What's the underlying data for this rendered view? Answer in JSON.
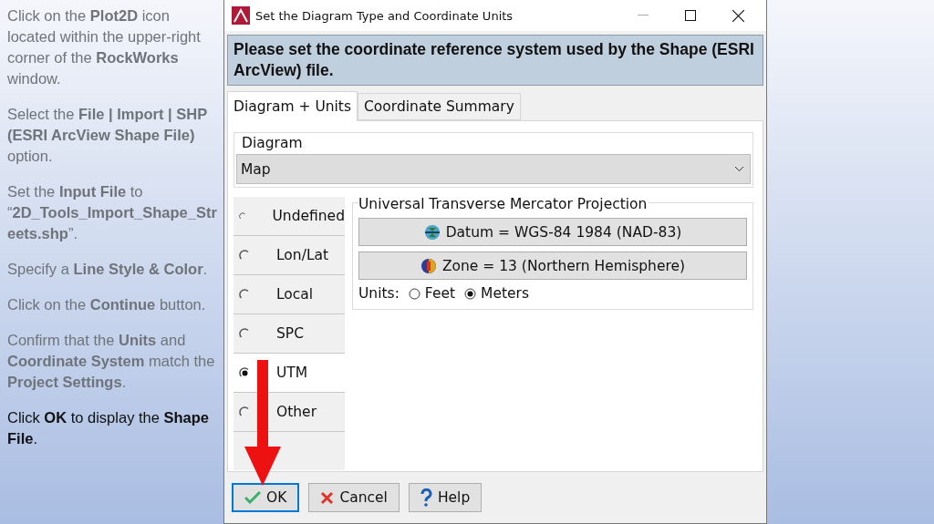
{
  "slide_steps": [
    {
      "text": "Click on the **Plot2D** icon located within the upper-right corner of the **RockWorks** window.",
      "current": false
    },
    {
      "text": "Select the **File | Import | SHP (ESRI ArcView Shape File)** option.",
      "current": false
    },
    {
      "text": "Set the **Input File** to “**2D_Tools_Import_Shape_Streets.shp**”.",
      "current": false
    },
    {
      "text": "Specify a **Line Style & Color**.",
      "current": false
    },
    {
      "text": "Click on the **Continue** button.",
      "current": false
    },
    {
      "text": "Confirm that the **Units** and **Coordinate System** match the **Project Settings**.",
      "current": false
    },
    {
      "text": "Click **OK** to display the **Shape File**.",
      "current": true
    }
  ],
  "dialog": {
    "title": "Set the Diagram Type and Coordinate Units",
    "header": "Please set the coordinate reference system used by the Shape (ESRI ArcView) file.",
    "tabs": [
      {
        "label": "Diagram + Units",
        "selected": true
      },
      {
        "label": "Coordinate Summary",
        "selected": false
      }
    ],
    "diagram": {
      "label": "Diagram",
      "value": "Map"
    },
    "systems": [
      {
        "label": "Undefined",
        "selected": false
      },
      {
        "label": "Lon/Lat",
        "selected": false
      },
      {
        "label": "Local",
        "selected": false
      },
      {
        "label": "SPC",
        "selected": false
      },
      {
        "label": "UTM",
        "selected": true
      },
      {
        "label": "Other",
        "selected": false
      }
    ],
    "projection": {
      "title": "Universal Transverse Mercator Projection",
      "buttons": [
        {
          "kind": "datum",
          "label": "Datum = WGS-84 1984 (NAD-83)"
        },
        {
          "kind": "zone",
          "label": "Zone = 13 (Northern Hemisphere)"
        }
      ],
      "units_label": "Units:",
      "units": [
        {
          "label": "Feet",
          "selected": false
        },
        {
          "label": "Meters",
          "selected": true
        }
      ]
    },
    "buttons": [
      {
        "kind": "ok",
        "label": "OK",
        "focused": true
      },
      {
        "kind": "cancel",
        "label": "Cancel",
        "focused": false
      },
      {
        "kind": "help",
        "label": "Help",
        "focused": false
      }
    ]
  }
}
